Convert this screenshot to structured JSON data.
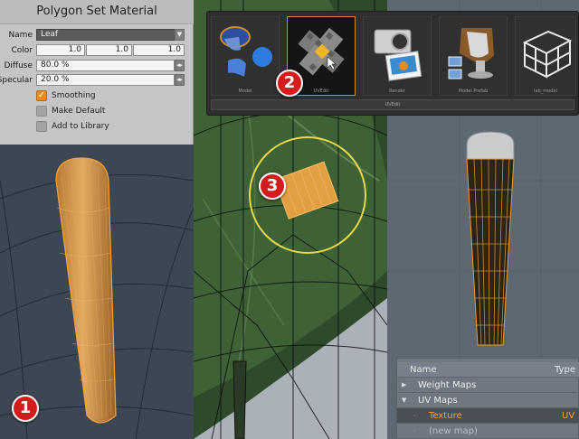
{
  "material_panel": {
    "title": "Polygon Set Material",
    "name_label": "Name",
    "name_value": "Leaf",
    "color_label": "Color",
    "color_values": [
      "1.0",
      "1.0",
      "1.0"
    ],
    "diffuse_label": "Diffuse",
    "diffuse_value": "80.0 %",
    "specular_label": "Specular",
    "specular_value": "20.0 %",
    "smoothing_label": "Smoothing",
    "smoothing_checked": true,
    "make_default_label": "Make Default",
    "add_to_library_label": "Add to Library"
  },
  "tool_palette": {
    "tools": [
      {
        "label": "Model",
        "icon": "model-icon"
      },
      {
        "label": "UVEdit",
        "icon": "uvedit-icon",
        "selected": true
      },
      {
        "label": "Render",
        "icon": "render-icon"
      },
      {
        "label": "Model Prefab",
        "icon": "model-prefab-icon"
      },
      {
        "label": "lab_model",
        "icon": "lab-model-icon"
      }
    ],
    "footer_label": "UVEdit"
  },
  "badges": [
    "1",
    "2",
    "3"
  ],
  "item_list": {
    "columns": [
      "Name",
      "Type"
    ],
    "rows": [
      {
        "name": "Weight Maps",
        "type": ""
      },
      {
        "name": "UV Maps",
        "type": ""
      },
      {
        "name": "Texture",
        "type": "UV",
        "selected": true
      },
      {
        "name": "(new map)",
        "type": ""
      }
    ]
  },
  "colors": {
    "accent": "#e88a1c",
    "badge": "#d41c1c",
    "selection_ring": "#e8d84a"
  }
}
